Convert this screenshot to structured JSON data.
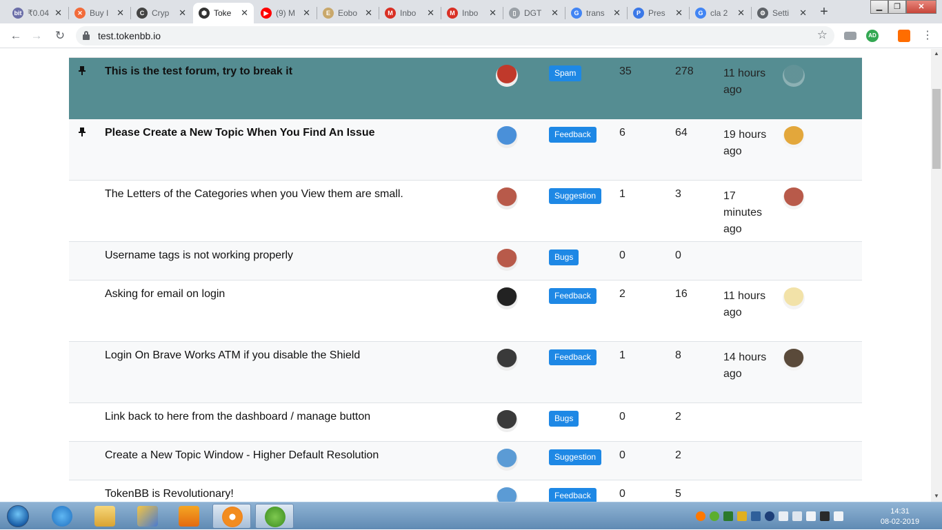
{
  "browser": {
    "tabs": [
      {
        "label": "₹0.04",
        "fav_color": "#6b6ea8",
        "fav_glyph": "bit",
        "icon": "bitbns-icon"
      },
      {
        "label": "Buy I",
        "fav_color": "#f26b3a",
        "fav_glyph": "✕",
        "icon": "exchange-icon"
      },
      {
        "label": "Cryp",
        "fav_color": "#444444",
        "fav_glyph": "C",
        "icon": "coinmarket-icon"
      },
      {
        "label": "Toke",
        "fav_color": "#333333",
        "fav_glyph": "⬢",
        "icon": "tokenbb-icon",
        "active": true
      },
      {
        "label": "(9) M",
        "fav_color": "#ff0000",
        "fav_glyph": "▶",
        "icon": "youtube-icon"
      },
      {
        "label": "Eobo",
        "fav_color": "#c9a86b",
        "fav_glyph": "E",
        "icon": "document-icon"
      },
      {
        "label": "Inbo",
        "fav_color": "#d93025",
        "fav_glyph": "M",
        "icon": "gmail-icon"
      },
      {
        "label": "Inbo",
        "fav_color": "#d93025",
        "fav_glyph": "M",
        "icon": "gmail-icon"
      },
      {
        "label": "DGT",
        "fav_color": "#9aa0a6",
        "fav_glyph": "▯",
        "icon": "page-icon"
      },
      {
        "label": "trans",
        "fav_color": "#4285f4",
        "fav_glyph": "G",
        "icon": "google-icon"
      },
      {
        "label": "Pres",
        "fav_color": "#3b78e7",
        "fav_glyph": "P",
        "icon": "presentation-icon"
      },
      {
        "label": "cla 2",
        "fav_color": "#4285f4",
        "fav_glyph": "G",
        "icon": "google-icon"
      },
      {
        "label": "Setti",
        "fav_color": "#5f6368",
        "fav_glyph": "⚙",
        "icon": "gear-icon"
      }
    ],
    "url": "test.tokenbb.io",
    "profile_initials": "AD"
  },
  "topics": [
    {
      "title": "This is the test forum, try to break it",
      "pinned": true,
      "bold": true,
      "highlight": true,
      "author_color": "#c0392b",
      "category": "Spam",
      "replies": "35",
      "views": "278",
      "activity": "11 hours ago",
      "last_color": "#7a9da0"
    },
    {
      "title": "Please Create a New Topic When You Find An Issue",
      "pinned": true,
      "bold": true,
      "author_color": "#4a90d9",
      "category": "Feedback",
      "replies": "6",
      "views": "64",
      "activity": "19 hours ago",
      "last_color": "#e3a73b"
    },
    {
      "title": "The Letters of the Categories when you View them are small.",
      "author_color": "#b85a4a",
      "category": "Suggestion",
      "replies": "1",
      "views": "3",
      "activity": "17 minutes ago",
      "last_color": "#b85a4a"
    },
    {
      "title": "Username tags is not working properly",
      "author_color": "#b85a4a",
      "category": "Bugs",
      "replies": "0",
      "views": "0",
      "activity": ""
    },
    {
      "title": "Asking for email on login",
      "author_color": "#222222",
      "category": "Feedback",
      "replies": "2",
      "views": "16",
      "activity": "11 hours ago",
      "last_color": "#f2e2a8"
    },
    {
      "title": "Login On Brave Works ATM if you disable the Shield",
      "author_color": "#3a3a3a",
      "category": "Feedback",
      "replies": "1",
      "views": "8",
      "activity": "14 hours ago",
      "last_color": "#5a4a3a"
    },
    {
      "title": "Link back to here from the dashboard / manage button",
      "author_color": "#3a3a3a",
      "category": "Bugs",
      "replies": "0",
      "views": "2",
      "activity": ""
    },
    {
      "title": "Create a New Topic Window - Higher Default Resolution",
      "author_color": "#5b9bd5",
      "category": "Suggestion",
      "replies": "0",
      "views": "2",
      "activity": ""
    },
    {
      "title": "TokenBB is Revolutionary!",
      "author_color": "#5b9bd5",
      "category": "Feedback",
      "replies": "0",
      "views": "5",
      "activity": ""
    }
  ],
  "taskbar": {
    "time": "14:31",
    "date": "08-02-2019"
  }
}
